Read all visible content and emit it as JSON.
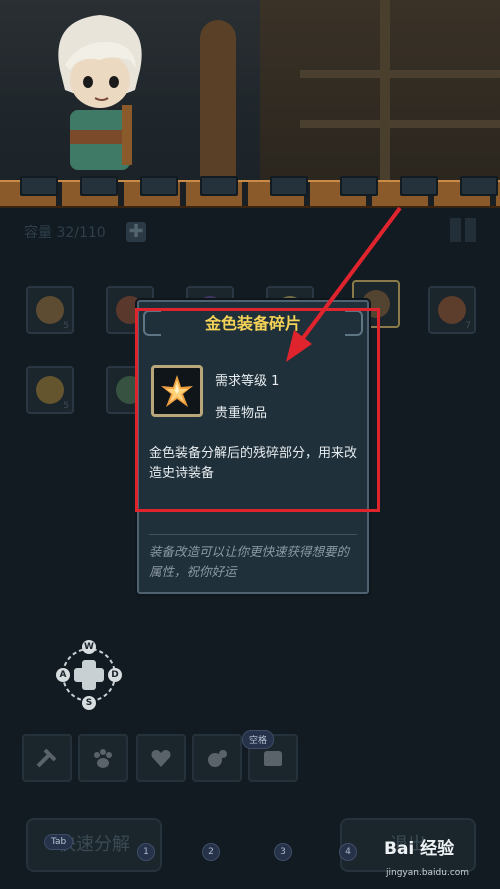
{
  "inventory": {
    "capacity_label": "容量 32/110",
    "add_icon": "plus-icon",
    "slots": [
      {
        "icon": "urn-icon",
        "count": "5",
        "color": "#b07a3a"
      },
      {
        "icon": "shield-item-icon",
        "count": "",
        "color": "#a8502a"
      },
      {
        "icon": "gem-item-icon",
        "count": "",
        "color": "#6a4aa8"
      },
      {
        "icon": "bag-item-icon",
        "count": "",
        "color": "#d8c060"
      },
      {
        "icon": "scroll-item-icon",
        "count": "",
        "color": "#9a6a3a"
      },
      {
        "icon": "potion-item-icon",
        "count": "7",
        "color": "#b05a2a"
      },
      {
        "icon": "key-item-icon",
        "count": "5",
        "color": "#c09030"
      },
      {
        "icon": "bowl-item-icon",
        "count": "",
        "color": "#5a8a5a"
      }
    ]
  },
  "tooltip": {
    "title": "金色装备碎片",
    "level": "需求等级 1",
    "category": "贵重物品",
    "description": "金色装备分解后的残碎部分，用来改造史诗装备",
    "flavor": "装备改造可以让你更快速获得想要的属性，祝你好运",
    "title_color": "#f3d257",
    "item_icon": "gold-crystal-icon"
  },
  "annotation": {
    "highlight_color": "#e0242e"
  },
  "controls": {
    "dpad": {
      "up": "W",
      "left": "A",
      "right": "D",
      "down": "S"
    },
    "skills": [
      "tools-icon",
      "paw-icon",
      "heart-icon",
      "bomb-icon",
      "chest-icon"
    ],
    "space_key": "空格",
    "tab_key": "Tab",
    "hotkeys": [
      "1",
      "2",
      "3",
      "4"
    ],
    "quick_decompose": "快速分解",
    "exit": "退出"
  },
  "watermark": {
    "main": "Bai 经验",
    "sub": "jingyan.baidu.com"
  }
}
